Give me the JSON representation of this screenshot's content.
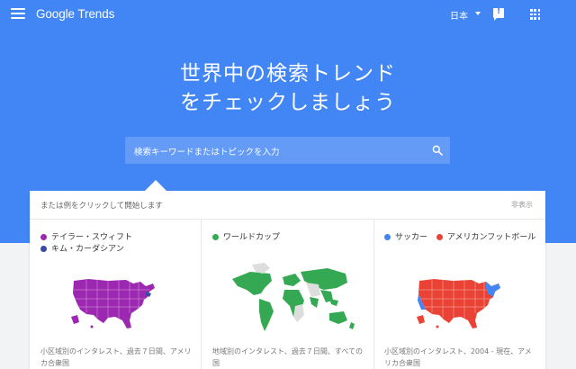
{
  "header": {
    "menu_icon": "hamburger-menu-icon",
    "logo_google": "Google",
    "logo_trends": "Trends",
    "language": "日本",
    "feedback_icon": "feedback-icon",
    "apps_icon": "apps-grid-icon"
  },
  "hero": {
    "line1": "世界中の検索トレンド",
    "line2": "をチェックしましょう",
    "search_placeholder": "検索キーワードまたはトピックを入力",
    "search_icon": "search-icon"
  },
  "examples": {
    "heading": "または例をクリックして開始します",
    "hide_label": "非表示",
    "cards": [
      {
        "terms": [
          {
            "label": "テイラー・スウィフト",
            "color": "#9c27b0"
          },
          {
            "label": "キム・カーダシアン",
            "color": "#3949ab"
          }
        ],
        "caption": "小区域別のインタレスト、過去７日間、アメリカ合衆国"
      },
      {
        "terms": [
          {
            "label": "ワールドカップ",
            "color": "#34a853"
          }
        ],
        "caption": "地域別のインタレスト、過去７日間、すべての国"
      },
      {
        "terms": [
          {
            "label": "サッカー",
            "color": "#4285f4"
          },
          {
            "label": "アメリカンフットボール",
            "color": "#ea4335"
          }
        ],
        "caption": "小区域別のインタレスト、2004 - 現在、アメリカ合衆国"
      }
    ]
  },
  "colors": {
    "hero_bg": "#4285f4",
    "page_bg": "#f1f3f4"
  }
}
